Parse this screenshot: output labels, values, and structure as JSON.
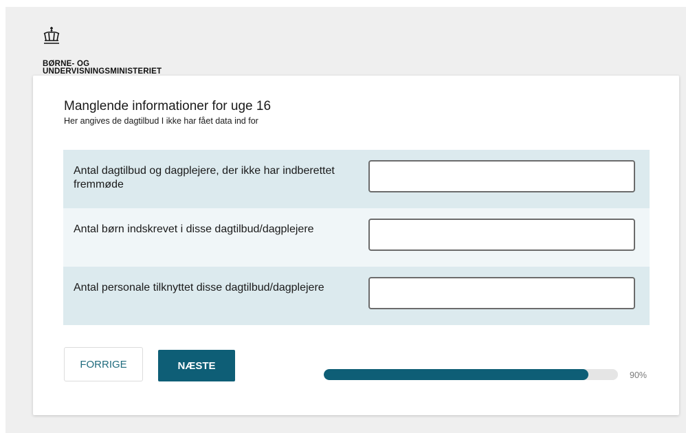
{
  "header": {
    "logo_icon": "crown-icon",
    "ministry_name": "BØRNE- OG\nUNDERVISNINGSMINISTERIET"
  },
  "card": {
    "title": "Manglende informationer for uge 16",
    "subtitle": "Her angives de dagtilbud I ikke har fået data ind for"
  },
  "form": {
    "rows": [
      {
        "label": "Antal dagtilbud og dagplejere, der ikke har indberettet fremmøde",
        "value": "",
        "placeholder": ""
      },
      {
        "label": "Antal børn indskrevet i disse dagtilbud/dagplejere",
        "value": "",
        "placeholder": ""
      },
      {
        "label": "Antal personale tilknyttet disse dagtilbud/dagplejere",
        "value": "",
        "placeholder": ""
      }
    ]
  },
  "navigation": {
    "prev_label": "FORRIGE",
    "next_label": "NÆSTE"
  },
  "progress": {
    "percent": 90,
    "label": "90%"
  },
  "colors": {
    "accent": "#0e5e76",
    "row_dark": "#dceaee",
    "row_light": "#f0f6f8",
    "page_background": "#efefef"
  }
}
